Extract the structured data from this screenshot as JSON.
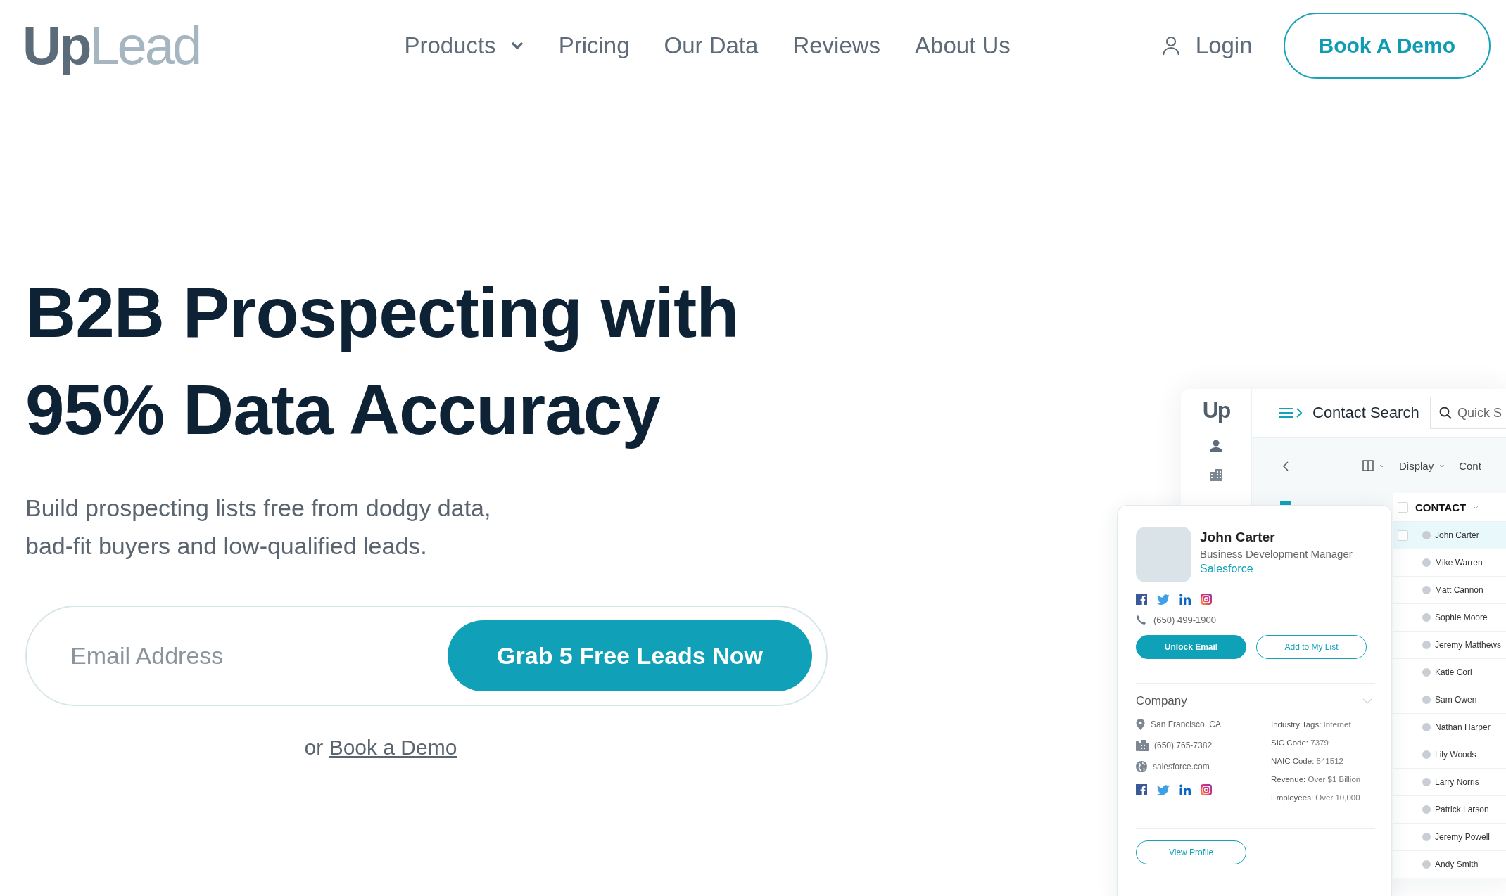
{
  "logo": {
    "first": "Up",
    "second": "Lead"
  },
  "nav": {
    "links": [
      {
        "label": "Products",
        "dropdown": true
      },
      {
        "label": "Pricing",
        "dropdown": false
      },
      {
        "label": "Our Data",
        "dropdown": false
      },
      {
        "label": "Reviews",
        "dropdown": false
      },
      {
        "label": "About Us",
        "dropdown": false
      }
    ],
    "login": "Login",
    "cta": "Book A Demo"
  },
  "hero": {
    "title_lines": [
      "B2B Prospecting with",
      "95% Data Accuracy"
    ],
    "subtitle_lines": [
      "Build prospecting lists free from dodgy data,",
      "bad-fit buyers and low-qualified leads."
    ],
    "email_placeholder": "Email Address",
    "submit": "Grab 5 Free Leads Now",
    "alt_prefix": "or",
    "alt_link": "Book a Demo"
  },
  "app": {
    "logo": "Up",
    "title": "Contact Search",
    "search_placeholder": "Quick S",
    "toolbar": {
      "display": "Display",
      "column_3": "Cont"
    },
    "table": {
      "header": "CONTACT",
      "select_all_checked": false,
      "rows": [
        {
          "name": "John Carter",
          "selected": true,
          "checked": false
        },
        {
          "name": "Mike Warren",
          "selected": false
        },
        {
          "name": "Matt Cannon",
          "selected": false
        },
        {
          "name": "Sophie Moore",
          "selected": false
        },
        {
          "name": "Jeremy Matthews",
          "selected": false
        },
        {
          "name": "Katie Corl",
          "selected": false
        },
        {
          "name": "Sam Owen",
          "selected": false
        },
        {
          "name": "Nathan Harper",
          "selected": false
        },
        {
          "name": "Lily Woods",
          "selected": false
        },
        {
          "name": "Larry Norris",
          "selected": false
        },
        {
          "name": "Patrick Larson",
          "selected": false
        },
        {
          "name": "Jeremy Powell",
          "selected": false
        },
        {
          "name": "Andy Smith",
          "selected": false
        }
      ]
    }
  },
  "card": {
    "name": "John Carter",
    "position": "Business Development Manager",
    "company": "Salesforce",
    "phone": "(650) 499-1900",
    "buttons": [
      {
        "label": "Unlock Email",
        "kind": "primary"
      },
      {
        "label": "Add to My List",
        "kind": "outline"
      }
    ],
    "section": "Company",
    "details": [
      {
        "kind": "location",
        "text": "San Francisco, CA"
      },
      {
        "kind": "phone",
        "text": "(650) 765-7382"
      },
      {
        "kind": "website",
        "text": "salesforce.com"
      }
    ],
    "facts": [
      {
        "label": "Industry Tags:",
        "value": "Internet"
      },
      {
        "label": "SIC Code:",
        "value": "7379"
      },
      {
        "label": "NAIC Code:",
        "value": "541512"
      },
      {
        "label": "Revenue:",
        "value": "Over $1 Billion"
      },
      {
        "label": "Employees:",
        "value": "Over 10,000"
      }
    ],
    "view_profile": "View Profile"
  }
}
